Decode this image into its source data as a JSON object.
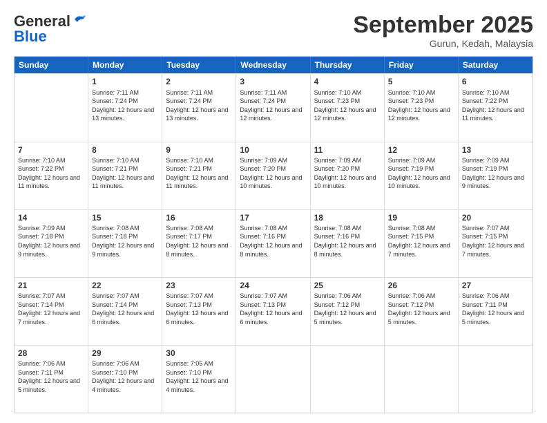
{
  "header": {
    "logo_line1": "General",
    "logo_line2": "Blue",
    "month_title": "September 2025",
    "subtitle": "Gurun, Kedah, Malaysia"
  },
  "days_of_week": [
    "Sunday",
    "Monday",
    "Tuesday",
    "Wednesday",
    "Thursday",
    "Friday",
    "Saturday"
  ],
  "weeks": [
    [
      {
        "day": "",
        "sunrise": "",
        "sunset": "",
        "daylight": ""
      },
      {
        "day": "1",
        "sunrise": "Sunrise: 7:11 AM",
        "sunset": "Sunset: 7:24 PM",
        "daylight": "Daylight: 12 hours and 13 minutes."
      },
      {
        "day": "2",
        "sunrise": "Sunrise: 7:11 AM",
        "sunset": "Sunset: 7:24 PM",
        "daylight": "Daylight: 12 hours and 13 minutes."
      },
      {
        "day": "3",
        "sunrise": "Sunrise: 7:11 AM",
        "sunset": "Sunset: 7:24 PM",
        "daylight": "Daylight: 12 hours and 12 minutes."
      },
      {
        "day": "4",
        "sunrise": "Sunrise: 7:10 AM",
        "sunset": "Sunset: 7:23 PM",
        "daylight": "Daylight: 12 hours and 12 minutes."
      },
      {
        "day": "5",
        "sunrise": "Sunrise: 7:10 AM",
        "sunset": "Sunset: 7:23 PM",
        "daylight": "Daylight: 12 hours and 12 minutes."
      },
      {
        "day": "6",
        "sunrise": "Sunrise: 7:10 AM",
        "sunset": "Sunset: 7:22 PM",
        "daylight": "Daylight: 12 hours and 11 minutes."
      }
    ],
    [
      {
        "day": "7",
        "sunrise": "Sunrise: 7:10 AM",
        "sunset": "Sunset: 7:22 PM",
        "daylight": "Daylight: 12 hours and 11 minutes."
      },
      {
        "day": "8",
        "sunrise": "Sunrise: 7:10 AM",
        "sunset": "Sunset: 7:21 PM",
        "daylight": "Daylight: 12 hours and 11 minutes."
      },
      {
        "day": "9",
        "sunrise": "Sunrise: 7:10 AM",
        "sunset": "Sunset: 7:21 PM",
        "daylight": "Daylight: 12 hours and 11 minutes."
      },
      {
        "day": "10",
        "sunrise": "Sunrise: 7:09 AM",
        "sunset": "Sunset: 7:20 PM",
        "daylight": "Daylight: 12 hours and 10 minutes."
      },
      {
        "day": "11",
        "sunrise": "Sunrise: 7:09 AM",
        "sunset": "Sunset: 7:20 PM",
        "daylight": "Daylight: 12 hours and 10 minutes."
      },
      {
        "day": "12",
        "sunrise": "Sunrise: 7:09 AM",
        "sunset": "Sunset: 7:19 PM",
        "daylight": "Daylight: 12 hours and 10 minutes."
      },
      {
        "day": "13",
        "sunrise": "Sunrise: 7:09 AM",
        "sunset": "Sunset: 7:19 PM",
        "daylight": "Daylight: 12 hours and 9 minutes."
      }
    ],
    [
      {
        "day": "14",
        "sunrise": "Sunrise: 7:09 AM",
        "sunset": "Sunset: 7:18 PM",
        "daylight": "Daylight: 12 hours and 9 minutes."
      },
      {
        "day": "15",
        "sunrise": "Sunrise: 7:08 AM",
        "sunset": "Sunset: 7:18 PM",
        "daylight": "Daylight: 12 hours and 9 minutes."
      },
      {
        "day": "16",
        "sunrise": "Sunrise: 7:08 AM",
        "sunset": "Sunset: 7:17 PM",
        "daylight": "Daylight: 12 hours and 8 minutes."
      },
      {
        "day": "17",
        "sunrise": "Sunrise: 7:08 AM",
        "sunset": "Sunset: 7:16 PM",
        "daylight": "Daylight: 12 hours and 8 minutes."
      },
      {
        "day": "18",
        "sunrise": "Sunrise: 7:08 AM",
        "sunset": "Sunset: 7:16 PM",
        "daylight": "Daylight: 12 hours and 8 minutes."
      },
      {
        "day": "19",
        "sunrise": "Sunrise: 7:08 AM",
        "sunset": "Sunset: 7:15 PM",
        "daylight": "Daylight: 12 hours and 7 minutes."
      },
      {
        "day": "20",
        "sunrise": "Sunrise: 7:07 AM",
        "sunset": "Sunset: 7:15 PM",
        "daylight": "Daylight: 12 hours and 7 minutes."
      }
    ],
    [
      {
        "day": "21",
        "sunrise": "Sunrise: 7:07 AM",
        "sunset": "Sunset: 7:14 PM",
        "daylight": "Daylight: 12 hours and 7 minutes."
      },
      {
        "day": "22",
        "sunrise": "Sunrise: 7:07 AM",
        "sunset": "Sunset: 7:14 PM",
        "daylight": "Daylight: 12 hours and 6 minutes."
      },
      {
        "day": "23",
        "sunrise": "Sunrise: 7:07 AM",
        "sunset": "Sunset: 7:13 PM",
        "daylight": "Daylight: 12 hours and 6 minutes."
      },
      {
        "day": "24",
        "sunrise": "Sunrise: 7:07 AM",
        "sunset": "Sunset: 7:13 PM",
        "daylight": "Daylight: 12 hours and 6 minutes."
      },
      {
        "day": "25",
        "sunrise": "Sunrise: 7:06 AM",
        "sunset": "Sunset: 7:12 PM",
        "daylight": "Daylight: 12 hours and 5 minutes."
      },
      {
        "day": "26",
        "sunrise": "Sunrise: 7:06 AM",
        "sunset": "Sunset: 7:12 PM",
        "daylight": "Daylight: 12 hours and 5 minutes."
      },
      {
        "day": "27",
        "sunrise": "Sunrise: 7:06 AM",
        "sunset": "Sunset: 7:11 PM",
        "daylight": "Daylight: 12 hours and 5 minutes."
      }
    ],
    [
      {
        "day": "28",
        "sunrise": "Sunrise: 7:06 AM",
        "sunset": "Sunset: 7:11 PM",
        "daylight": "Daylight: 12 hours and 5 minutes."
      },
      {
        "day": "29",
        "sunrise": "Sunrise: 7:06 AM",
        "sunset": "Sunset: 7:10 PM",
        "daylight": "Daylight: 12 hours and 4 minutes."
      },
      {
        "day": "30",
        "sunrise": "Sunrise: 7:05 AM",
        "sunset": "Sunset: 7:10 PM",
        "daylight": "Daylight: 12 hours and 4 minutes."
      },
      {
        "day": "",
        "sunrise": "",
        "sunset": "",
        "daylight": ""
      },
      {
        "day": "",
        "sunrise": "",
        "sunset": "",
        "daylight": ""
      },
      {
        "day": "",
        "sunrise": "",
        "sunset": "",
        "daylight": ""
      },
      {
        "day": "",
        "sunrise": "",
        "sunset": "",
        "daylight": ""
      }
    ]
  ]
}
